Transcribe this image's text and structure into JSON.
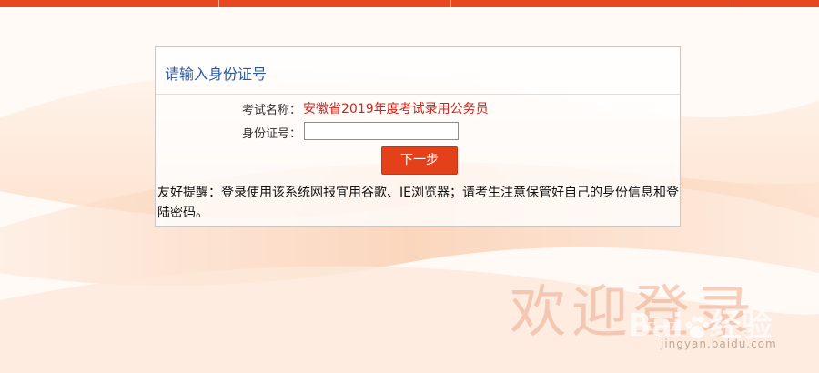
{
  "panel": {
    "title": "请输入身份证号",
    "exam_label": "考试名称：",
    "exam_name": "安徽省2019年度考试录用公务员",
    "id_label": "身份证号：",
    "id_value": "",
    "next_button": "下一步",
    "tip": "友好提醒：登录使用该系统网报宜用谷歌、IE浏览器；请考生注意保管好自己的身份信息和登陆密码。"
  },
  "background": {
    "welcome_text": "欢迎登录"
  },
  "watermark": {
    "brand": "Bai",
    "brand_suffix": "经验",
    "url": "jingyan.baidu.com"
  },
  "colors": {
    "accent": "#e4411b",
    "title_blue": "#2b5aa5",
    "exam_red": "#d2231a"
  },
  "icons": {
    "watermark_paw": "paw-icon"
  }
}
